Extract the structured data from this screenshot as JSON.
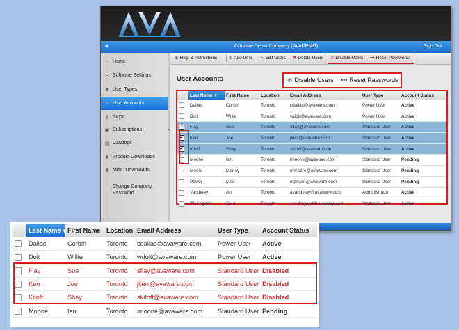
{
  "header": {
    "logo_letters": "AVA",
    "app_title": "AVAware Demo Company (AVADEMO)",
    "sign_out": "Sign Out"
  },
  "sidebar": {
    "items": [
      {
        "label": "Home",
        "icon": "house-icon"
      },
      {
        "label": "Software Settings",
        "icon": "gear-icon"
      },
      {
        "label": "User Types",
        "icon": "user-types-icon"
      },
      {
        "label": "User Accounts",
        "icon": "user-icon",
        "active": true
      },
      {
        "label": "Keys",
        "icon": "key-icon"
      },
      {
        "label": "Subscriptions",
        "icon": "subscription-icon"
      },
      {
        "label": "Catalogs",
        "icon": "catalog-icon"
      },
      {
        "label": "Product Downloads",
        "icon": "download-icon"
      },
      {
        "label": "Misc. Downloads",
        "icon": "download-icon"
      },
      {
        "label": "Change Company Password",
        "icon": "password-icon"
      }
    ]
  },
  "toolbar": {
    "help": "Help & Instructions",
    "add_user": "Add User",
    "edit_users": "Edit Users",
    "delete_users": "Delete Users",
    "disable_users": "Disable Users",
    "reset_passwords": "Reset Passwords"
  },
  "section_title": "User Accounts",
  "callout": {
    "disable_users": "Disable Users",
    "reset_passwords": "Reset Passwords"
  },
  "table": {
    "columns": [
      "",
      "Last Name",
      "First Name",
      "Location",
      "Email Address",
      "User Type",
      "Account Status"
    ],
    "sort_indicator": "▾",
    "rows": [
      {
        "checked": false,
        "selected": false,
        "last": "Dallas",
        "first": "Corbin",
        "location": "Toronto",
        "email": "cdallas@avaware.com",
        "type": "Power User",
        "status": "Active"
      },
      {
        "checked": false,
        "selected": false,
        "last": "Doit",
        "first": "Willie",
        "location": "Toronto",
        "email": "wdoit@avaware.com",
        "type": "Power User",
        "status": "Active"
      },
      {
        "checked": true,
        "selected": true,
        "last": "Flay",
        "first": "Sue",
        "location": "Toronto",
        "email": "sflay@avaware.com",
        "type": "Standard User",
        "status": "Active"
      },
      {
        "checked": true,
        "selected": true,
        "last": "Kerr",
        "first": "Joe",
        "location": "Toronto",
        "email": "jkerr@avaware.com",
        "type": "Standard User",
        "status": "Active"
      },
      {
        "checked": true,
        "selected": true,
        "last": "Kitoff",
        "first": "Shay",
        "location": "Toronto",
        "email": "skitoff@avaware.com",
        "type": "Standard User",
        "status": "Active"
      },
      {
        "checked": false,
        "selected": false,
        "last": "Moone",
        "first": "Ian",
        "location": "Toronto",
        "email": "imoone@avaware.com",
        "type": "Standard User",
        "status": "Pending"
      },
      {
        "checked": false,
        "selected": false,
        "last": "Moore",
        "first": "Manny",
        "location": "Toronto",
        "email": "mmoore@avaware.com",
        "type": "Standard User",
        "status": "Pending"
      },
      {
        "checked": false,
        "selected": false,
        "last": "Power",
        "first": "Max",
        "location": "Toronto",
        "email": "mpower@avaware.com",
        "type": "Standard User",
        "status": "Pending"
      },
      {
        "checked": false,
        "selected": false,
        "last": "Vandelay",
        "first": "Art",
        "location": "Toronto",
        "email": "avandelay@avaware.com",
        "type": "Administrator",
        "status": "Active"
      },
      {
        "checked": false,
        "selected": false,
        "last": "Wellingood",
        "first": "Saul",
        "location": "Toronto",
        "email": "swellingood@avaware.com",
        "type": "Standard User",
        "status": "Active"
      }
    ]
  },
  "zoom_table": {
    "columns": [
      "",
      "Last Name",
      "First Name",
      "Location",
      "Email Address",
      "User Type",
      "Account Status"
    ],
    "sort_indicator": "▾",
    "rows": [
      {
        "disabled": false,
        "last": "Dallas",
        "first": "Corbin",
        "location": "Toronto",
        "email": "cdallas@avaware.com",
        "type": "Power User",
        "status": "Active"
      },
      {
        "disabled": false,
        "last": "Doit",
        "first": "Willie",
        "location": "Toronto",
        "email": "wdoit@avaware.com",
        "type": "Power User",
        "status": "Active"
      },
      {
        "disabled": true,
        "last": "Flay",
        "first": "Sue",
        "location": "Toronto",
        "email": "sflay@avaware.com",
        "type": "Standard User",
        "status": "Disabled"
      },
      {
        "disabled": true,
        "last": "Kerr",
        "first": "Joe",
        "location": "Toronto",
        "email": "jkerr@avaware.com",
        "type": "Standard User",
        "status": "Disabled"
      },
      {
        "disabled": true,
        "last": "Kitoff",
        "first": "Shay",
        "location": "Toronto",
        "email": "skitoff@avaware.com",
        "type": "Standard User",
        "status": "Disabled"
      },
      {
        "disabled": false,
        "last": "Moone",
        "first": "Ian",
        "location": "Toronto",
        "email": "imoone@avaware.com",
        "type": "Standard User",
        "status": "Pending"
      }
    ]
  },
  "colors": {
    "accent_blue": "#1c6fcc",
    "highlight_red": "#d81e1e",
    "status_active": "#1da81d",
    "status_pending": "#e29a12",
    "status_disabled": "#d42020"
  }
}
